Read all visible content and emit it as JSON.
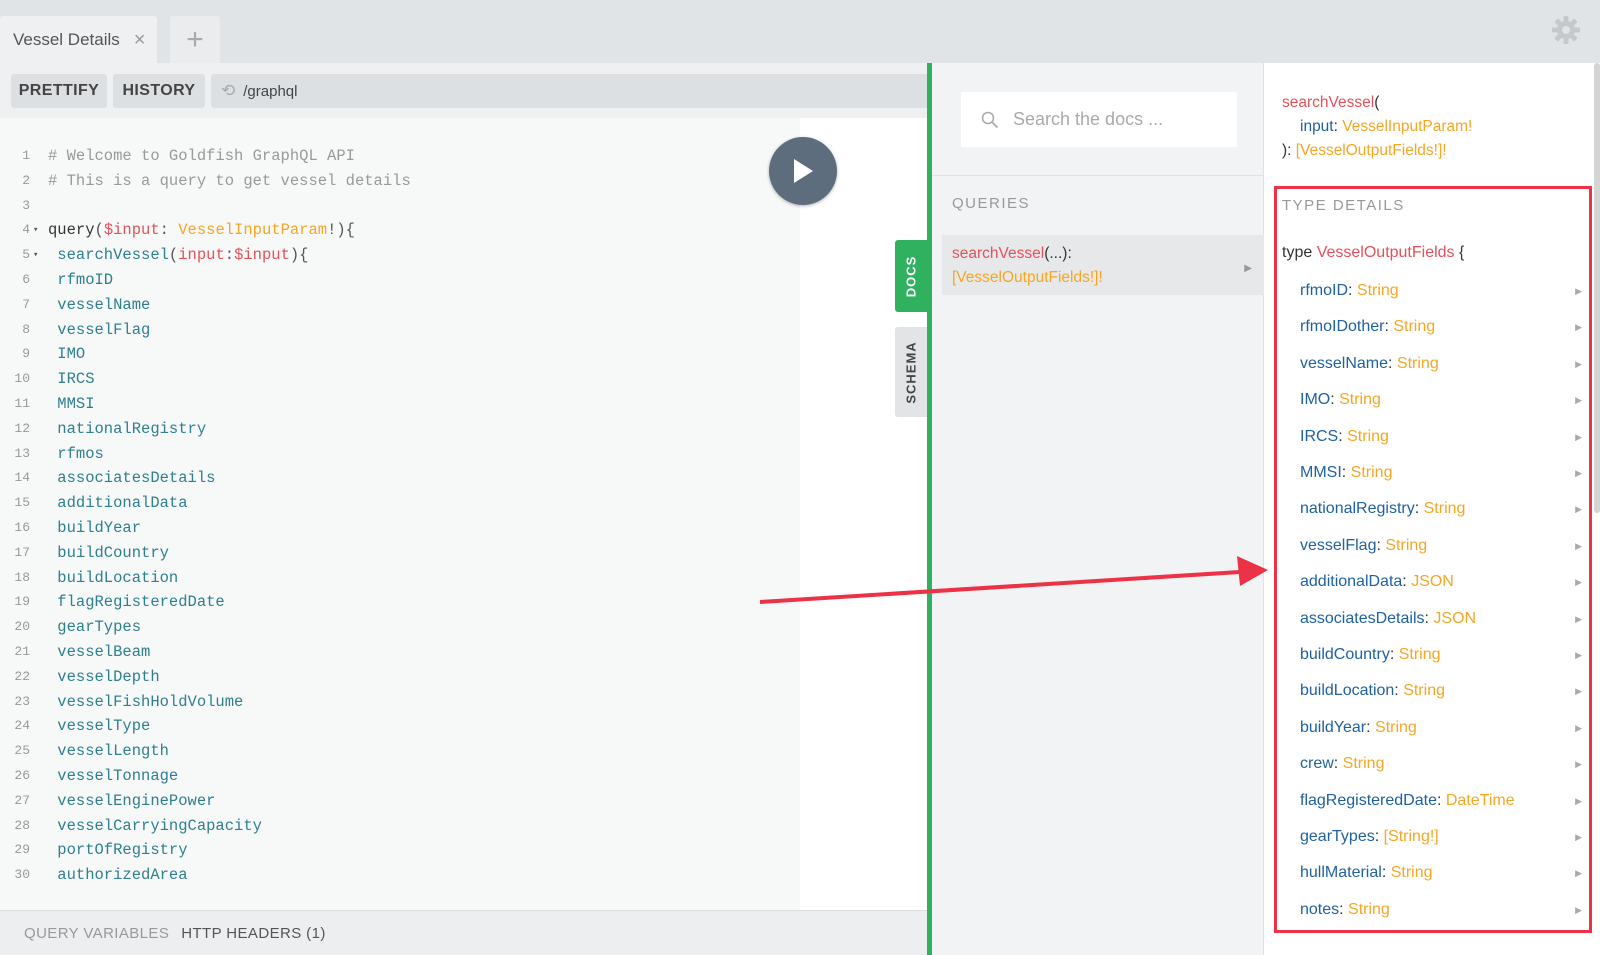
{
  "tabs": [
    {
      "label": "Vessel Details",
      "close": "×"
    }
  ],
  "new_tab_label": "+",
  "toolbar": {
    "prettify": "PRETTIFY",
    "history": "HISTORY",
    "endpoint": "/graphql"
  },
  "editor": {
    "lines": [
      {
        "n": "1",
        "segments": [
          {
            "t": "# Welcome to Goldfish GraphQL API",
            "c": "comment"
          }
        ]
      },
      {
        "n": "2",
        "segments": [
          {
            "t": "# This is a query to get vessel details",
            "c": "comment"
          }
        ]
      },
      {
        "n": "3",
        "segments": []
      },
      {
        "n": "4",
        "fold": "▾",
        "segments": [
          {
            "t": "query",
            "c": "kw"
          },
          {
            "t": "(",
            "c": "plain"
          },
          {
            "t": "$input",
            "c": "var"
          },
          {
            "t": ": ",
            "c": "plain"
          },
          {
            "t": "VesselInputParam",
            "c": "type"
          },
          {
            "t": "!){",
            "c": "plain"
          }
        ]
      },
      {
        "n": "5",
        "fold": "▾",
        "segments": [
          {
            "t": " searchVessel",
            "c": "ind"
          },
          {
            "t": "(",
            "c": "plain"
          },
          {
            "t": "input",
            "c": "var"
          },
          {
            "t": ":",
            "c": "plain"
          },
          {
            "t": "$input",
            "c": "var"
          },
          {
            "t": "){",
            "c": "plain"
          }
        ]
      },
      {
        "n": "6",
        "segments": [
          {
            "t": " rfmoID",
            "c": "ind"
          }
        ]
      },
      {
        "n": "7",
        "segments": [
          {
            "t": " vesselName",
            "c": "ind"
          }
        ]
      },
      {
        "n": "8",
        "segments": [
          {
            "t": " vesselFlag",
            "c": "ind"
          }
        ]
      },
      {
        "n": "9",
        "segments": [
          {
            "t": " IMO",
            "c": "ind"
          }
        ]
      },
      {
        "n": "10",
        "segments": [
          {
            "t": " IRCS",
            "c": "ind"
          }
        ]
      },
      {
        "n": "11",
        "segments": [
          {
            "t": " MMSI",
            "c": "ind"
          }
        ]
      },
      {
        "n": "12",
        "segments": [
          {
            "t": " nationalRegistry",
            "c": "ind"
          }
        ]
      },
      {
        "n": "13",
        "segments": [
          {
            "t": " rfmos",
            "c": "ind"
          }
        ]
      },
      {
        "n": "14",
        "segments": [
          {
            "t": " associatesDetails",
            "c": "ind"
          }
        ]
      },
      {
        "n": "15",
        "segments": [
          {
            "t": " additionalData",
            "c": "ind"
          }
        ]
      },
      {
        "n": "16",
        "segments": [
          {
            "t": " buildYear",
            "c": "ind"
          }
        ]
      },
      {
        "n": "17",
        "segments": [
          {
            "t": " buildCountry",
            "c": "ind"
          }
        ]
      },
      {
        "n": "18",
        "segments": [
          {
            "t": " buildLocation",
            "c": "ind"
          }
        ]
      },
      {
        "n": "19",
        "segments": [
          {
            "t": " flagRegisteredDate",
            "c": "ind"
          }
        ]
      },
      {
        "n": "20",
        "segments": [
          {
            "t": " gearTypes",
            "c": "ind"
          }
        ]
      },
      {
        "n": "21",
        "segments": [
          {
            "t": " vesselBeam",
            "c": "ind"
          }
        ]
      },
      {
        "n": "22",
        "segments": [
          {
            "t": " vesselDepth",
            "c": "ind"
          }
        ]
      },
      {
        "n": "23",
        "segments": [
          {
            "t": " vesselFishHoldVolume",
            "c": "ind"
          }
        ]
      },
      {
        "n": "24",
        "segments": [
          {
            "t": " vesselType",
            "c": "ind"
          }
        ]
      },
      {
        "n": "25",
        "segments": [
          {
            "t": " vesselLength",
            "c": "ind"
          }
        ]
      },
      {
        "n": "26",
        "segments": [
          {
            "t": " vesselTonnage",
            "c": "ind"
          }
        ]
      },
      {
        "n": "27",
        "segments": [
          {
            "t": " vesselEnginePower",
            "c": "ind"
          }
        ]
      },
      {
        "n": "28",
        "segments": [
          {
            "t": " vesselCarryingCapacity",
            "c": "ind"
          }
        ]
      },
      {
        "n": "29",
        "segments": [
          {
            "t": " portOfRegistry",
            "c": "ind"
          }
        ]
      },
      {
        "n": "30",
        "segments": [
          {
            "t": " authorizedArea",
            "c": "ind"
          }
        ]
      }
    ]
  },
  "bottom": {
    "query_variables": "QUERY VARIABLES",
    "http_headers": "HTTP HEADERS (1)"
  },
  "side_tabs": {
    "docs": "DOCS",
    "schema": "SCHEMA"
  },
  "docs": {
    "search_placeholder": "Search the docs ...",
    "queries_heading": "QUERIES",
    "query_item": {
      "name": "searchVessel",
      "args": "(...):",
      "return": "[VesselOutputFields!]!"
    },
    "signature": {
      "name": "searchVessel",
      "open": "(",
      "arg_name": "input",
      "colon": ": ",
      "arg_type": "VesselInputParam!",
      "close": "): ",
      "return": "[VesselOutputFields!]!"
    },
    "type_details_heading": "TYPE DETAILS",
    "type_keyword": "type",
    "type_name": "VesselOutputFields",
    "type_brace": "{",
    "fields": [
      {
        "name": "rfmoID",
        "type": "String"
      },
      {
        "name": "rfmoIDother",
        "type": "String"
      },
      {
        "name": "vesselName",
        "type": "String"
      },
      {
        "name": "IMO",
        "type": "String"
      },
      {
        "name": "IRCS",
        "type": "String"
      },
      {
        "name": "MMSI",
        "type": "String"
      },
      {
        "name": "nationalRegistry",
        "type": "String"
      },
      {
        "name": "vesselFlag",
        "type": "String"
      },
      {
        "name": "additionalData",
        "type": "JSON"
      },
      {
        "name": "associatesDetails",
        "type": "JSON"
      },
      {
        "name": "buildCountry",
        "type": "String"
      },
      {
        "name": "buildLocation",
        "type": "String"
      },
      {
        "name": "buildYear",
        "type": "String"
      },
      {
        "name": "crew",
        "type": "String"
      },
      {
        "name": "flagRegisteredDate",
        "type": "DateTime"
      },
      {
        "name": "gearTypes",
        "type": "[String!]"
      },
      {
        "name": "hullMaterial",
        "type": "String"
      },
      {
        "name": "notes",
        "type": "String"
      }
    ]
  },
  "icons": {
    "settings": "gear-icon",
    "run": "play-icon",
    "search": "search-icon",
    "refresh": "refresh-icon"
  },
  "colors": {
    "accent_green": "#2fb15f",
    "run_button": "#5e6d7d",
    "annotation_red": "#ec3247",
    "field_blue": "#1f61a0",
    "type_orange": "#f5a623",
    "name_red": "#e4515b"
  }
}
